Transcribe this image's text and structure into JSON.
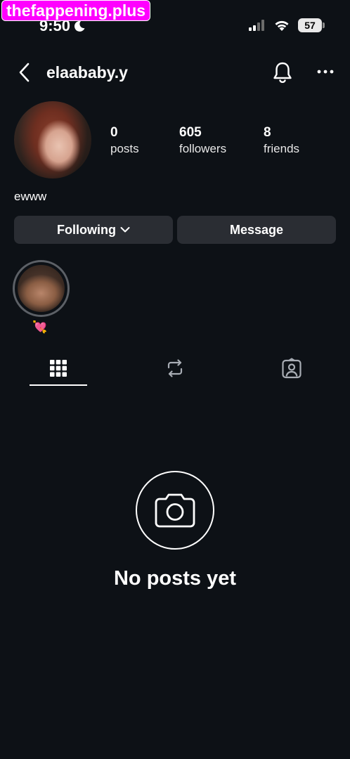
{
  "watermark": "thefappening.plus",
  "status_bar": {
    "time": "9:50",
    "battery": "57"
  },
  "header": {
    "username": "elaababy.y"
  },
  "profile": {
    "stats": [
      {
        "value": "0",
        "label": "posts"
      },
      {
        "value": "605",
        "label": "followers"
      },
      {
        "value": "8",
        "label": "friends"
      }
    ],
    "bio": "ewww"
  },
  "actions": {
    "following_label": "Following",
    "message_label": "Message"
  },
  "highlights": [
    {
      "label": "💘"
    }
  ],
  "tabs": [
    {
      "icon": "grid-icon",
      "active": true
    },
    {
      "icon": "repost-icon",
      "active": false
    },
    {
      "icon": "tagged-icon",
      "active": false
    }
  ],
  "empty_state": {
    "icon": "camera-icon",
    "text": "No posts yet"
  }
}
